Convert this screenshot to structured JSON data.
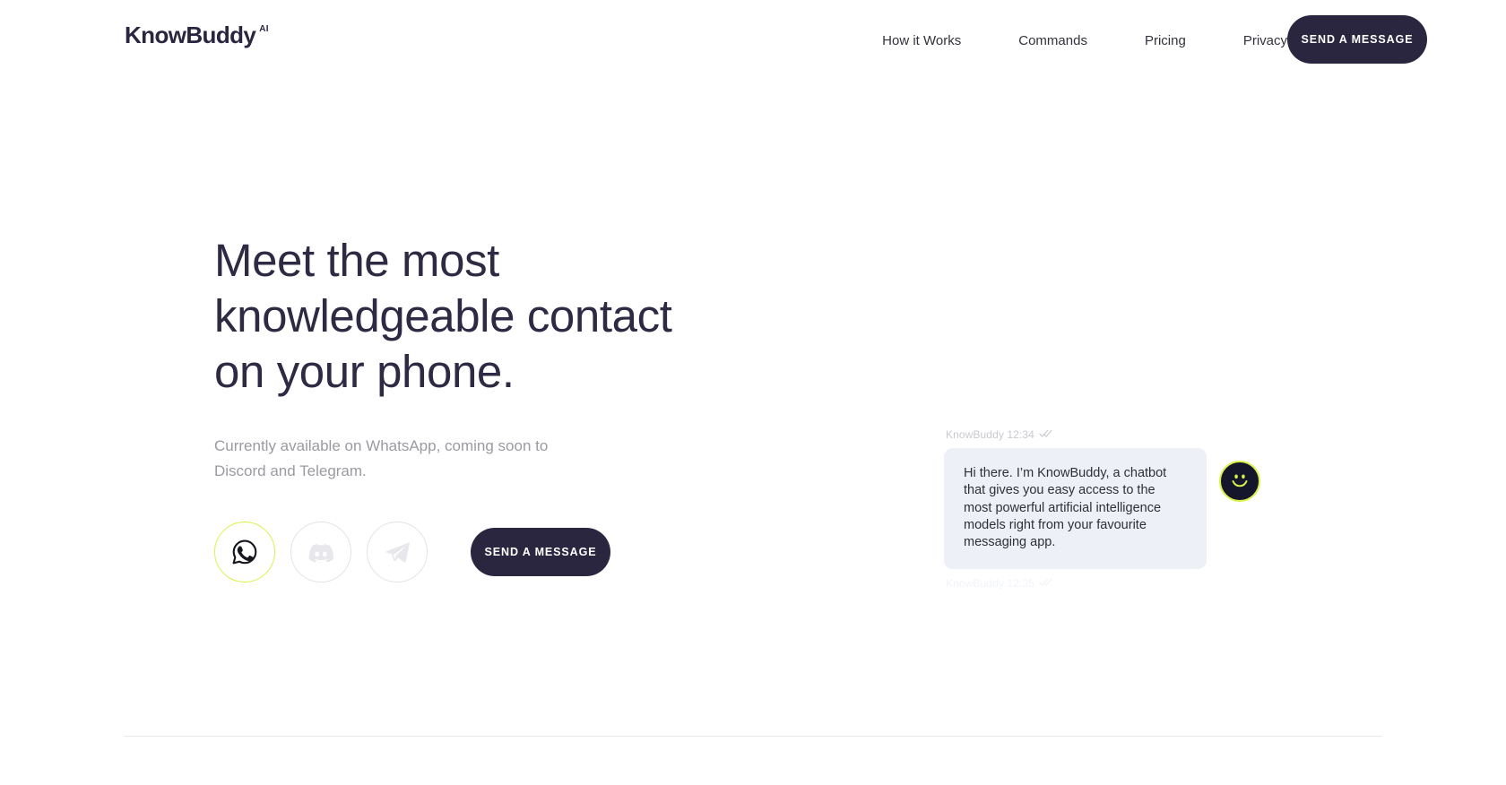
{
  "brand": {
    "name": "KnowBuddy",
    "superscript": "AI",
    "accent_color": "#d8f24a",
    "dark_color": "#2b2640"
  },
  "header": {
    "nav_items": [
      {
        "label": "How it Works"
      },
      {
        "label": "Commands"
      },
      {
        "label": "Pricing"
      },
      {
        "label": "Privacy"
      }
    ],
    "cta_label": "SEND A MESSAGE"
  },
  "hero": {
    "headline_line1": "Meet the most",
    "headline_line2": "knowledgeable contact",
    "headline_line3": "on your phone.",
    "subhead_line1": "Currently available on WhatsApp, coming soon to",
    "subhead_line2": "Discord and Telegram.",
    "cta_label": "SEND A MESSAGE",
    "social_icons": [
      {
        "name": "whatsapp-icon",
        "label": "WhatsApp",
        "active": true
      },
      {
        "name": "discord-icon",
        "label": "Discord",
        "active": false
      },
      {
        "name": "telegram-icon",
        "label": "Telegram",
        "active": false
      }
    ]
  },
  "chat": {
    "sender": "KnowBuddy",
    "timestamp": "12:34",
    "meta_line": "KnowBuddy 12:34",
    "message": "Hi there. I’m KnowBuddy, a chatbot that gives you easy access to the most powerful artificial intelligence models right from your favourite messaging app.",
    "faded_meta_line": "KnowBuddy 12:35",
    "avatar_icon": "smiley-face-icon"
  }
}
